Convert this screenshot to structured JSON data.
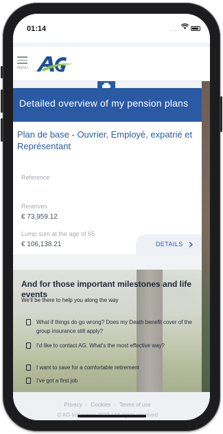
{
  "status_bar": {
    "time": "01:14",
    "signal": "....",
    "wifi_icon": "wifi-icon",
    "battery_icon": "battery-icon"
  },
  "header": {
    "menu_label": "MENU",
    "logo_text": "AG",
    "brand_colors": {
      "blue": "#1f4e9d",
      "green": "#8cc63f"
    }
  },
  "banner": {
    "title": "Detailed overview of my pension plans",
    "color": "#2b5aa4"
  },
  "plan": {
    "title": "Plan de base - Ouvrier, Employé, expatrié et Représentant",
    "fields": [
      {
        "label": "Reference",
        "value": ""
      },
      {
        "label": "Reserves",
        "value": "€ 73,959.12"
      },
      {
        "label": "Lump sum at the age of 65",
        "value": "€ 106,138.21"
      }
    ],
    "details_label": "DETAILS"
  },
  "milestones": {
    "title": "And for those important milestones and life events",
    "subtitle": "We'll be there to help you along the way",
    "links": [
      "What if things do go wrong? Does my Death benefit cover of the group insurance still apply?",
      "I'd like to contact AG. What's the most effective way?",
      "I want to save for a comfortable retirement",
      "I've got a first job"
    ]
  },
  "footer": {
    "links": [
      "Privacy",
      "Cookies",
      "Terms of use"
    ],
    "copyright": "© AG Insurance 2022 / All rights reserved"
  }
}
